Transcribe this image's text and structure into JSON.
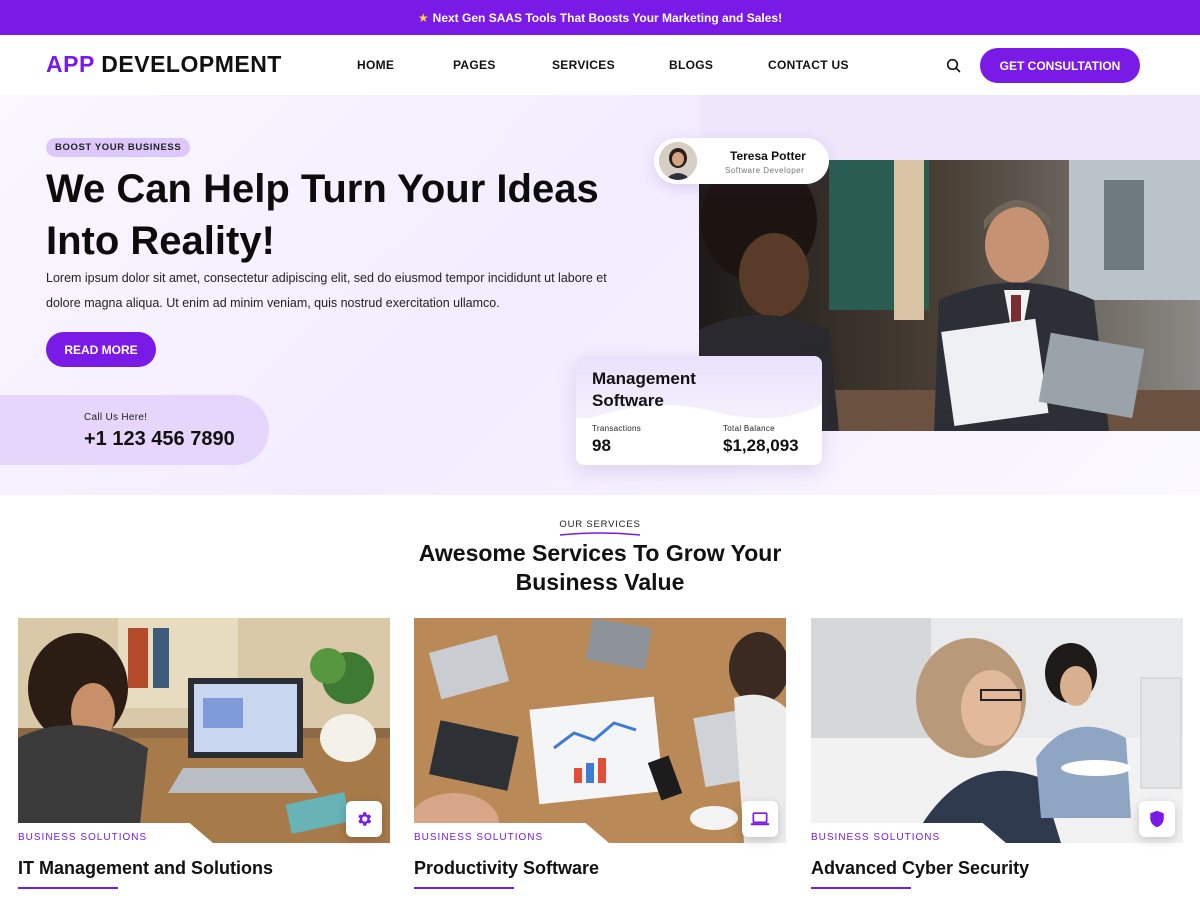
{
  "announcement": {
    "icon": "star-icon",
    "text": "Next Gen SAAS Tools That Boosts Your Marketing and Sales!"
  },
  "header": {
    "logo_accent": "APP",
    "logo_rest": "DEVELOPMENT",
    "nav": [
      "HOME",
      "PAGES",
      "SERVICES",
      "BLOGS",
      "CONTACT US"
    ],
    "cta_label": "GET CONSULTATION"
  },
  "hero": {
    "badge": "BOOST YOUR BUSINESS",
    "title": "We Can Help Turn Your Ideas Into Reality!",
    "text": "Lorem ipsum dolor sit amet, consectetur adipiscing elit, sed do eiusmod tempor incididunt ut labore et dolore magna aliqua. Ut enim ad minim veniam, quis nostrud exercitation ullamco.",
    "button": "READ MORE",
    "call_label": "Call Us Here!",
    "call_number": "+1 123 456 7890"
  },
  "profile": {
    "name": "Teresa Potter",
    "role": "Software Developer"
  },
  "management_card": {
    "title": "Management Software",
    "transactions_label": "Transactions",
    "transactions_value": "98",
    "balance_label": "Total Balance",
    "balance_value": "$1,28,093"
  },
  "services": {
    "eyebrow": "OUR SERVICES",
    "title": "Awesome Services To Grow Your Business Value",
    "cards": [
      {
        "category": "BUSINESS SOLUTIONS",
        "title": "IT Management and Solutions",
        "icon": "gear-icon"
      },
      {
        "category": "BUSINESS SOLUTIONS",
        "title": "Productivity Software",
        "icon": "laptop-icon"
      },
      {
        "category": "BUSINESS SOLUTIONS",
        "title": "Advanced Cyber Security",
        "icon": "shield-icon"
      }
    ]
  },
  "colors": {
    "accent": "#7a1ae6",
    "badge_bg": "#dcc8fb",
    "call_bg": "#e6d6fb"
  }
}
